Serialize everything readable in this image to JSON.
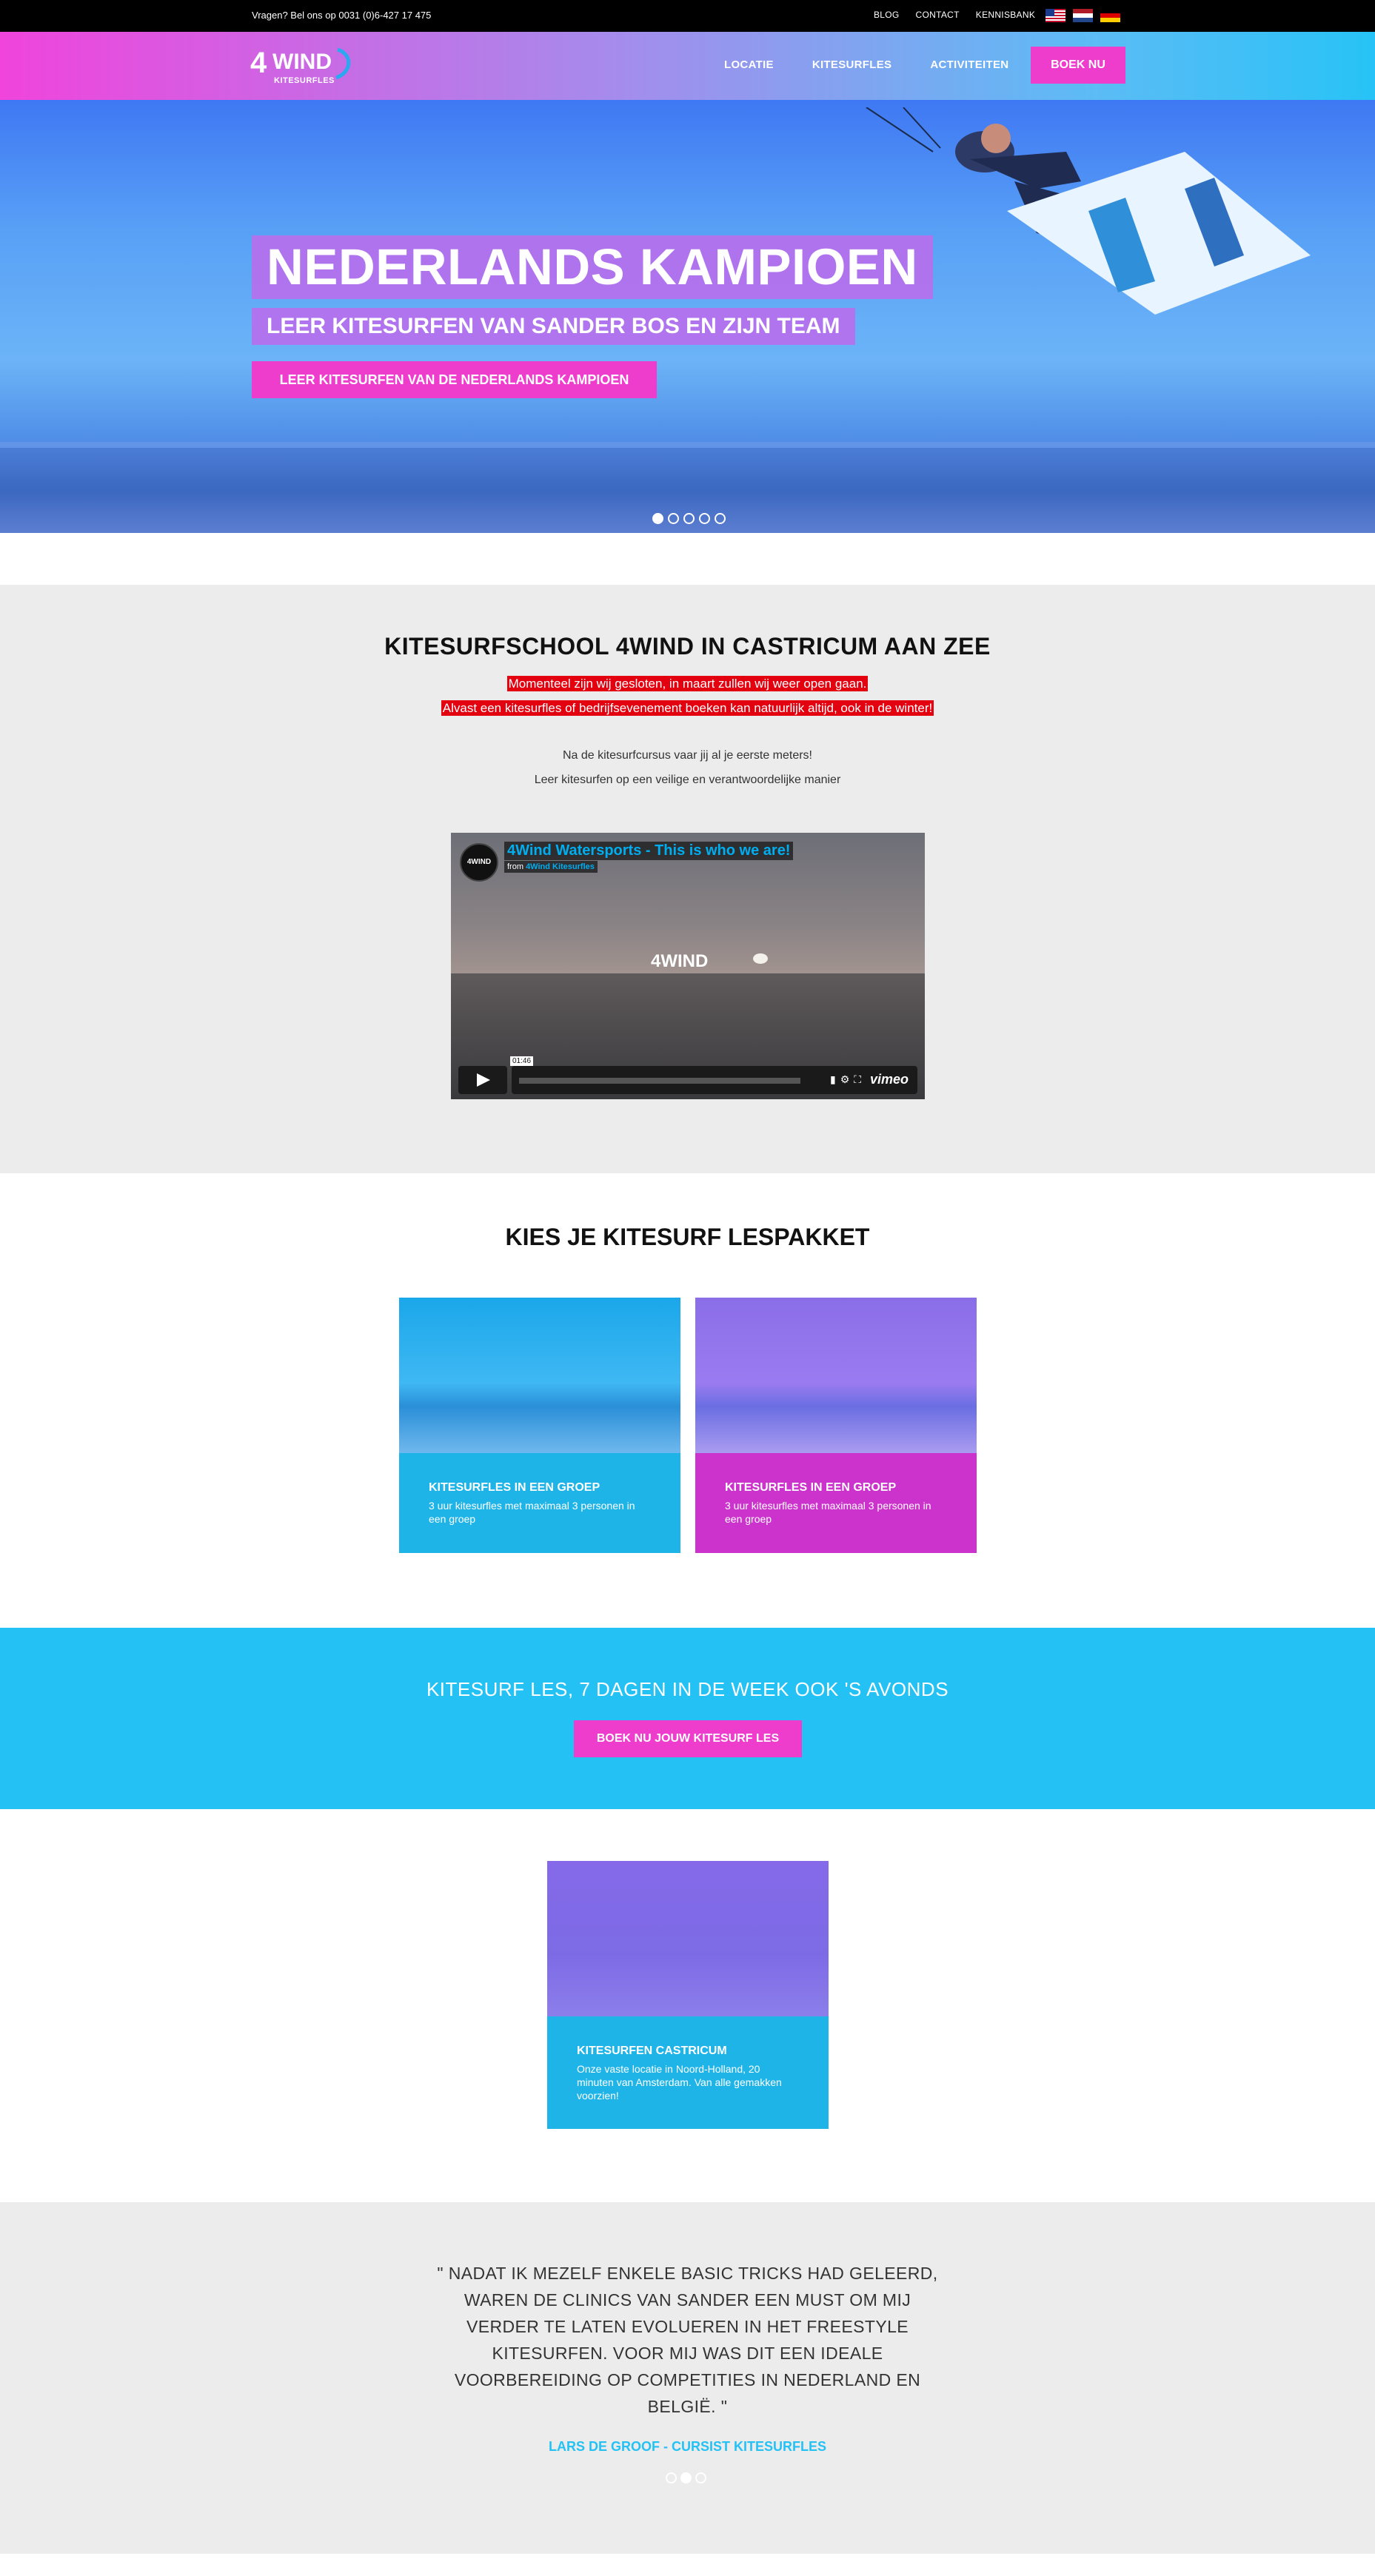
{
  "topbar": {
    "phone_prefix": "Vragen? Bel ons op",
    "phone_number": "0031 (0)6-427 17 475",
    "links": [
      "BLOG",
      "CONTACT",
      "KENNISBANK"
    ]
  },
  "header": {
    "logo_num": "4",
    "logo_word": "WIND",
    "logo_sub": "KITESURFLES",
    "nav": [
      "LOCATIE",
      "KITESURFLES",
      "ACTIVITEITEN"
    ],
    "cta": "BOEK NU"
  },
  "hero": {
    "title": "NEDERLANDS KAMPIOEN",
    "subtitle": "LEER KITESURFEN VAN SANDER BOS EN ZIJN TEAM",
    "button": "LEER KITESURFEN VAN DE NEDERLANDS KAMPIOEN",
    "slides": 5,
    "active_slide": 1
  },
  "intro": {
    "title": "KITESURFSCHOOL 4WIND IN CASTRICUM AAN ZEE",
    "notice_1": "Momenteel zijn wij gesloten, in maart zullen wij weer open gaan.",
    "notice_2": "Alvast een kitesurfles of bedrijfsevenement boeken kan natuurlijk altijd, ook in de winter!",
    "para_1": "Na de kitesurfcursus vaar jij al je eerste meters!",
    "para_2": "Leer kitesurfen op een veilige en verantwoordelijke manier"
  },
  "video": {
    "channel_badge": "4WIND",
    "title": "4Wind Watersports - This is who we are!",
    "from_label": "from",
    "from_name": "4Wind Kitesurfles",
    "time": "01:46",
    "brand": "vimeo",
    "logo_text": "4WIND"
  },
  "packages": {
    "title": "KIES JE KITESURF LESPAKKET",
    "cards": [
      {
        "title": "KITESURFLES IN EEN GROEP",
        "desc": "3 uur kitesurfles met maximaal 3 personen in een groep"
      },
      {
        "title": "KITESURFLES IN EEN GROEP",
        "desc": "3 uur kitesurfles met maximaal 3 personen in een groep"
      }
    ]
  },
  "cta": {
    "text": "KITESURF LES, 7 DAGEN IN DE WEEK OOK 'S AVONDS",
    "button": "BOEK NU JOUW KITESURF LES"
  },
  "location": {
    "title": "KITESURFEN CASTRICUM",
    "desc": "Onze vaste locatie in Noord-Holland, 20 minuten van Amsterdam. Van alle gemakken voorzien!"
  },
  "testimonial": {
    "quote": "\" NADAT IK MEZELF ENKELE BASIC TRICKS HAD GELEERD, WAREN DE CLINICS VAN SANDER EEN MUST OM MIJ VERDER TE LATEN EVOLUEREN IN HET FREESTYLE KITESURFEN. VOOR MIJ WAS DIT EEN IDEALE VOORBEREIDING OP COMPETITIES IN NEDERLAND EN BELGIË. \"",
    "author": "LARS DE GROOF - CURSIST KITESURFLES",
    "slides": 3,
    "active_slide": 2
  },
  "colors": {
    "pink": "#ee3ccd",
    "cyan": "#24c1f5",
    "purple": "#b86eec",
    "notice_red": "#e3000f"
  }
}
